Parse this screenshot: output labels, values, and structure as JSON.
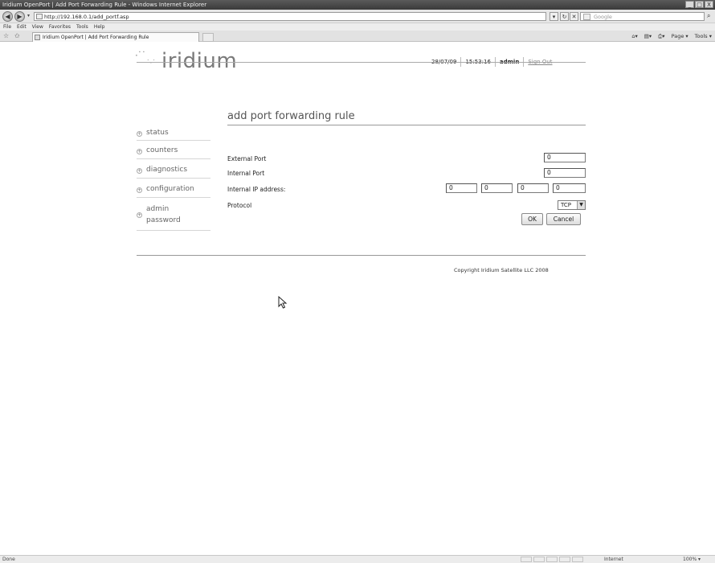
{
  "browser": {
    "window_title": "Iridium OpenPort | Add Port Forwarding Rule - Windows Internet Explorer",
    "window_buttons": [
      "_",
      "□",
      "X"
    ],
    "url": "http://192.168.0.1/add_portf.asp",
    "search_placeholder": "Google",
    "menu": [
      "File",
      "Edit",
      "View",
      "Favorites",
      "Tools",
      "Help"
    ],
    "tab_title": "Iridium OpenPort | Add Port Forwarding Rule",
    "command_bar": [
      "Page ▾",
      "Tools ▾"
    ],
    "status_text": "Done",
    "zone": "Internet",
    "zoom": "100% ▾"
  },
  "header": {
    "logo_text": "iridium",
    "date": "28/07/09",
    "time": "15:53:16",
    "user": "admin",
    "signout": "Sign Out"
  },
  "sidebar": {
    "items": [
      {
        "label": "status"
      },
      {
        "label": "counters"
      },
      {
        "label": "diagnostics"
      },
      {
        "label": "configuration"
      },
      {
        "label": "admin password"
      }
    ]
  },
  "page": {
    "title": "add port forwarding rule"
  },
  "form": {
    "external_port_label": "External Port",
    "external_port_value": "0",
    "internal_port_label": "Internal Port",
    "internal_port_value": "0",
    "internal_ip_label": "Internal IP address:",
    "ip": [
      "0",
      "0",
      "0",
      "0"
    ],
    "protocol_label": "Protocol",
    "protocol_value": "TCP",
    "ok_label": "OK",
    "cancel_label": "Cancel"
  },
  "footer": {
    "copyright": "Copyright Iridium Satellite LLC 2008"
  }
}
